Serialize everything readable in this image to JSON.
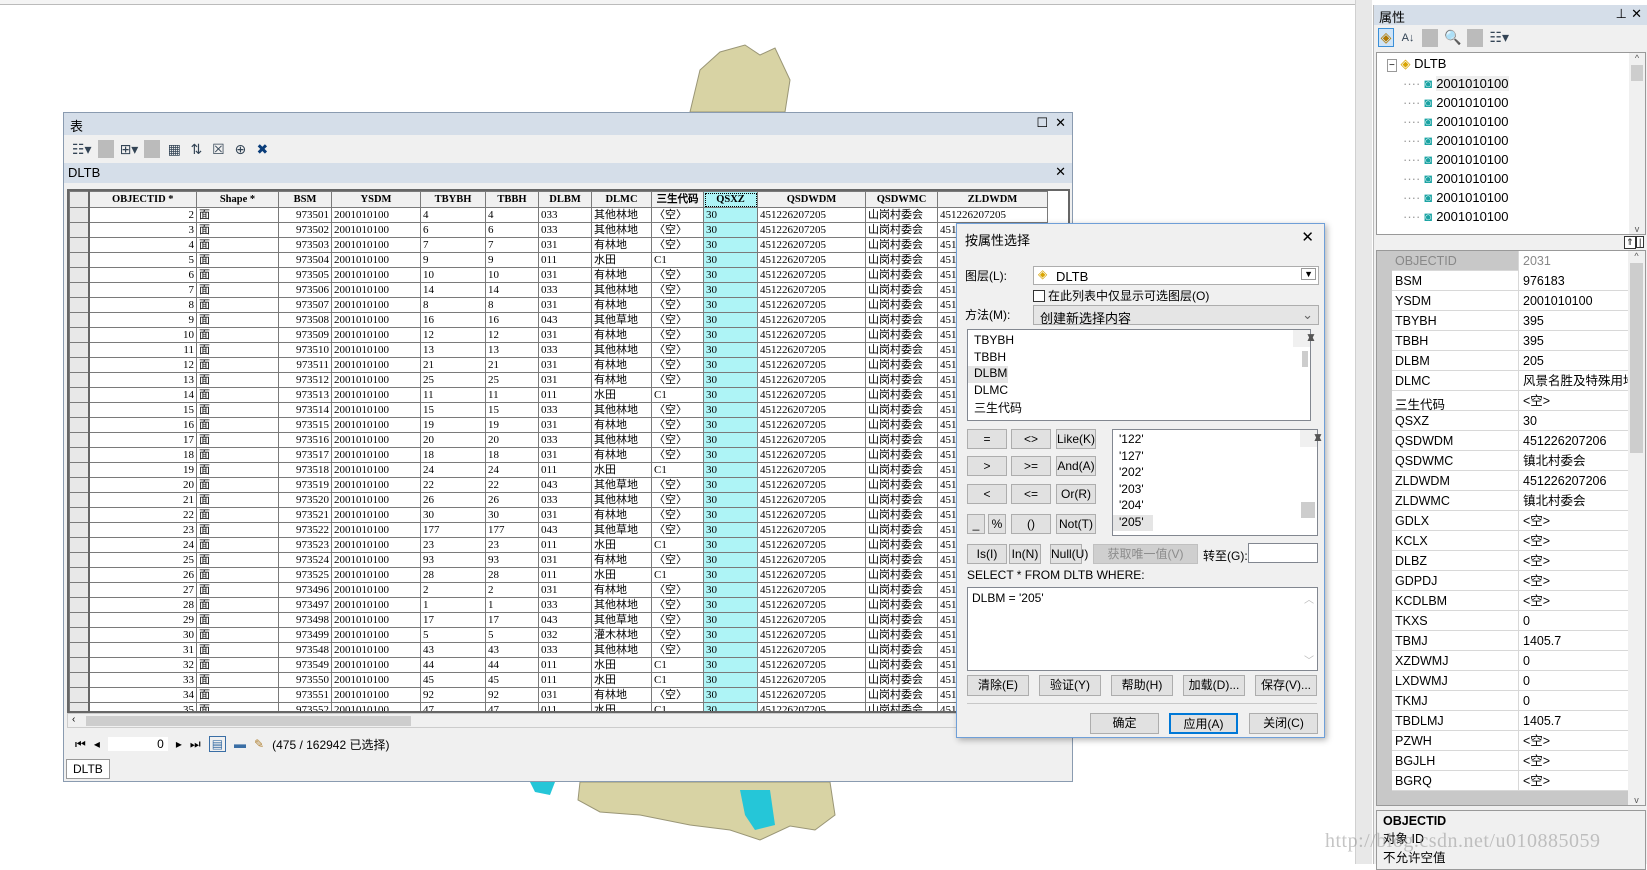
{
  "colors": {
    "selected_column": "#aef4f6",
    "title_bar": "#d5dee9",
    "map_fill": "#d8d3a4",
    "map_water": "#25c6d8"
  },
  "table_window": {
    "title": "表",
    "toolbar_icons": [
      "table-options-icon",
      "related-tables-icon",
      "select-by-attributes-icon",
      "switch-selection-icon",
      "clear-selection-icon",
      "zoom-to-selected-icon",
      "delete-selected-icon"
    ],
    "layer_title": "DLTB",
    "columns": [
      "OBJECTID *",
      "Shape *",
      "BSM",
      "YSDM",
      "TBYBH",
      "TBBH",
      "DLBM",
      "DLMC",
      "三生代码",
      "QSXZ",
      "QSDWDM",
      "QSDWMC",
      "ZLDWDM"
    ],
    "rows": [
      [
        "2",
        "面",
        "973501",
        "2001010100",
        "4",
        "4",
        "033",
        "其他林地",
        "〈空〉",
        "30",
        "451226207205",
        "山岗村委会",
        "451226207205"
      ],
      [
        "3",
        "面",
        "973502",
        "2001010100",
        "6",
        "6",
        "033",
        "其他林地",
        "〈空〉",
        "30",
        "451226207205",
        "山岗村委会",
        "451"
      ],
      [
        "4",
        "面",
        "973503",
        "2001010100",
        "7",
        "7",
        "031",
        "有林地",
        "〈空〉",
        "30",
        "451226207205",
        "山岗村委会",
        "451"
      ],
      [
        "5",
        "面",
        "973504",
        "2001010100",
        "9",
        "9",
        "011",
        "水田",
        "C1",
        "30",
        "451226207205",
        "山岗村委会",
        "451"
      ],
      [
        "6",
        "面",
        "973505",
        "2001010100",
        "10",
        "10",
        "031",
        "有林地",
        "〈空〉",
        "30",
        "451226207205",
        "山岗村委会",
        "451"
      ],
      [
        "7",
        "面",
        "973506",
        "2001010100",
        "14",
        "14",
        "033",
        "其他林地",
        "〈空〉",
        "30",
        "451226207205",
        "山岗村委会",
        "451"
      ],
      [
        "8",
        "面",
        "973507",
        "2001010100",
        "8",
        "8",
        "031",
        "有林地",
        "〈空〉",
        "30",
        "451226207205",
        "山岗村委会",
        "451"
      ],
      [
        "9",
        "面",
        "973508",
        "2001010100",
        "16",
        "16",
        "043",
        "其他草地",
        "〈空〉",
        "30",
        "451226207205",
        "山岗村委会",
        "451"
      ],
      [
        "10",
        "面",
        "973509",
        "2001010100",
        "12",
        "12",
        "031",
        "有林地",
        "〈空〉",
        "30",
        "451226207205",
        "山岗村委会",
        "451"
      ],
      [
        "11",
        "面",
        "973510",
        "2001010100",
        "13",
        "13",
        "033",
        "其他林地",
        "〈空〉",
        "30",
        "451226207205",
        "山岗村委会",
        "451"
      ],
      [
        "12",
        "面",
        "973511",
        "2001010100",
        "21",
        "21",
        "031",
        "有林地",
        "〈空〉",
        "30",
        "451226207205",
        "山岗村委会",
        "451"
      ],
      [
        "13",
        "面",
        "973512",
        "2001010100",
        "25",
        "25",
        "031",
        "有林地",
        "〈空〉",
        "30",
        "451226207205",
        "山岗村委会",
        "451"
      ],
      [
        "14",
        "面",
        "973513",
        "2001010100",
        "11",
        "11",
        "011",
        "水田",
        "C1",
        "30",
        "451226207205",
        "山岗村委会",
        "451"
      ],
      [
        "15",
        "面",
        "973514",
        "2001010100",
        "15",
        "15",
        "033",
        "其他林地",
        "〈空〉",
        "30",
        "451226207205",
        "山岗村委会",
        "451"
      ],
      [
        "16",
        "面",
        "973515",
        "2001010100",
        "19",
        "19",
        "031",
        "有林地",
        "〈空〉",
        "30",
        "451226207205",
        "山岗村委会",
        "451"
      ],
      [
        "17",
        "面",
        "973516",
        "2001010100",
        "20",
        "20",
        "033",
        "其他林地",
        "〈空〉",
        "30",
        "451226207205",
        "山岗村委会",
        "451"
      ],
      [
        "18",
        "面",
        "973517",
        "2001010100",
        "18",
        "18",
        "031",
        "有林地",
        "〈空〉",
        "30",
        "451226207205",
        "山岗村委会",
        "451"
      ],
      [
        "19",
        "面",
        "973518",
        "2001010100",
        "24",
        "24",
        "011",
        "水田",
        "C1",
        "30",
        "451226207205",
        "山岗村委会",
        "451"
      ],
      [
        "20",
        "面",
        "973519",
        "2001010100",
        "22",
        "22",
        "043",
        "其他草地",
        "〈空〉",
        "30",
        "451226207205",
        "山岗村委会",
        "451"
      ],
      [
        "21",
        "面",
        "973520",
        "2001010100",
        "26",
        "26",
        "033",
        "其他林地",
        "〈空〉",
        "30",
        "451226207205",
        "山岗村委会",
        "451"
      ],
      [
        "22",
        "面",
        "973521",
        "2001010100",
        "30",
        "30",
        "031",
        "有林地",
        "〈空〉",
        "30",
        "451226207205",
        "山岗村委会",
        "451"
      ],
      [
        "23",
        "面",
        "973522",
        "2001010100",
        "177",
        "177",
        "043",
        "其他草地",
        "〈空〉",
        "30",
        "451226207205",
        "山岗村委会",
        "451"
      ],
      [
        "24",
        "面",
        "973523",
        "2001010100",
        "23",
        "23",
        "011",
        "水田",
        "C1",
        "30",
        "451226207205",
        "山岗村委会",
        "451"
      ],
      [
        "25",
        "面",
        "973524",
        "2001010100",
        "93",
        "93",
        "031",
        "有林地",
        "〈空〉",
        "30",
        "451226207205",
        "山岗村委会",
        "451"
      ],
      [
        "26",
        "面",
        "973525",
        "2001010100",
        "28",
        "28",
        "011",
        "水田",
        "C1",
        "30",
        "451226207205",
        "山岗村委会",
        "451"
      ],
      [
        "27",
        "面",
        "973496",
        "2001010100",
        "2",
        "2",
        "031",
        "有林地",
        "〈空〉",
        "30",
        "451226207205",
        "山岗村委会",
        "451"
      ],
      [
        "28",
        "面",
        "973497",
        "2001010100",
        "1",
        "1",
        "033",
        "其他林地",
        "〈空〉",
        "30",
        "451226207205",
        "山岗村委会",
        "451"
      ],
      [
        "29",
        "面",
        "973498",
        "2001010100",
        "17",
        "17",
        "043",
        "其他草地",
        "〈空〉",
        "30",
        "451226207205",
        "山岗村委会",
        "451"
      ],
      [
        "30",
        "面",
        "973499",
        "2001010100",
        "5",
        "5",
        "032",
        "灌木林地",
        "〈空〉",
        "30",
        "451226207205",
        "山岗村委会",
        "451"
      ],
      [
        "31",
        "面",
        "973548",
        "2001010100",
        "43",
        "43",
        "033",
        "其他林地",
        "〈空〉",
        "30",
        "451226207205",
        "山岗村委会",
        "451"
      ],
      [
        "32",
        "面",
        "973549",
        "2001010100",
        "44",
        "44",
        "011",
        "水田",
        "C1",
        "30",
        "451226207205",
        "山岗村委会",
        "451"
      ],
      [
        "33",
        "面",
        "973550",
        "2001010100",
        "45",
        "45",
        "011",
        "水田",
        "C1",
        "30",
        "451226207205",
        "山岗村委会",
        "451"
      ],
      [
        "34",
        "面",
        "973551",
        "2001010100",
        "92",
        "92",
        "031",
        "有林地",
        "〈空〉",
        "30",
        "451226207205",
        "山岗村委会",
        "451"
      ],
      [
        "35",
        "面",
        "973552",
        "2001010100",
        "47",
        "47",
        "011",
        "水田",
        "C1",
        "30",
        "451226207205",
        "山岗村委会",
        "451"
      ]
    ],
    "current_record": "0",
    "selection_status": "(475 / 162942 已选择)",
    "bottom_tab": "DLTB"
  },
  "dialog": {
    "title": "按属性选择",
    "layer_label": "图层(L):",
    "layer_value": "DLTB",
    "only_selectable_label": "在此列表中仅显示可选图层(O)",
    "only_selectable_checked": false,
    "method_label": "方法(M):",
    "method_value": "创建新选择内容",
    "fields": [
      "TBYBH",
      "TBBH",
      "DLBM",
      "DLMC",
      "三生代码"
    ],
    "selected_field": "DLBM",
    "operators": [
      "=",
      "<>",
      "Like(K)",
      ">",
      ">=",
      "And(A)",
      "<",
      "<=",
      "Or(R)",
      "_",
      "%",
      "()",
      "Not(T)",
      "Is(I)",
      "In(N)",
      "Null(U)"
    ],
    "unique_values": [
      "'122'",
      "'127'",
      "'202'",
      "'203'",
      "'204'",
      "'205'"
    ],
    "selected_value": "'205'",
    "get_unique_label": "获取唯一值(V)",
    "goto_label": "转至(G):",
    "goto_value": "",
    "sql_prefix": "SELECT * FROM DLTB WHERE:",
    "sql_expression": "DLBM = '205'",
    "action_buttons": [
      "清除(E)",
      "验证(Y)",
      "帮助(H)",
      "加载(D)...",
      "保存(V)..."
    ],
    "ok": "确定",
    "apply": "应用(A)",
    "close": "关闭(C)"
  },
  "properties": {
    "title": "属性",
    "root": "DLTB",
    "tree_items": [
      "2001010100",
      "2001010100",
      "2001010100",
      "2001010100",
      "2001010100",
      "2001010100",
      "2001010100",
      "2001010100"
    ],
    "rows": [
      [
        "OBJECTID",
        "2031"
      ],
      [
        "BSM",
        "976183"
      ],
      [
        "YSDM",
        "2001010100"
      ],
      [
        "TBYBH",
        "395"
      ],
      [
        "TBBH",
        "395"
      ],
      [
        "DLBM",
        "205"
      ],
      [
        "DLMC",
        "风景名胜及特殊用地"
      ],
      [
        "三生代码",
        "<空>"
      ],
      [
        "QSXZ",
        "30"
      ],
      [
        "QSDWDM",
        "451226207206"
      ],
      [
        "QSDWMC",
        "镇北村委会"
      ],
      [
        "ZLDWDM",
        "451226207206"
      ],
      [
        "ZLDWMC",
        "镇北村委会"
      ],
      [
        "GDLX",
        "<空>"
      ],
      [
        "KCLX",
        "<空>"
      ],
      [
        "DLBZ",
        "<空>"
      ],
      [
        "GDPDJ",
        "<空>"
      ],
      [
        "KCDLBM",
        "<空>"
      ],
      [
        "TKXS",
        "0"
      ],
      [
        "TBMJ",
        "1405.7"
      ],
      [
        "XZDWMJ",
        "0"
      ],
      [
        "LXDWMJ",
        "0"
      ],
      [
        "TKMJ",
        "0"
      ],
      [
        "TBDLMJ",
        "1405.7"
      ],
      [
        "PZWH",
        "<空>"
      ],
      [
        "BGJLH",
        "<空>"
      ],
      [
        "BGRQ",
        "<空>"
      ]
    ],
    "desc_title": "OBJECTID",
    "desc_line1": "对象 ID",
    "desc_line2": "不允许空值"
  },
  "watermark": "http://blog.csdn.net/u010885059"
}
